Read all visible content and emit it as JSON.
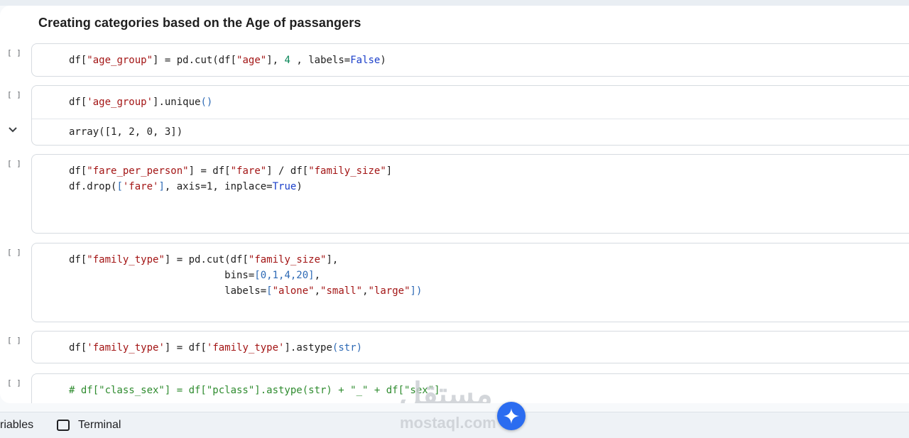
{
  "heading": "Creating categories based on the Age of passangers",
  "run_marker": "[ ]",
  "cells": [
    {
      "lines": [
        [
          [
            "df[",
            "t"
          ],
          [
            "\"age_group\"",
            "s"
          ],
          [
            "] = pd.cut(df[",
            "t"
          ],
          [
            "\"age\"",
            "s"
          ],
          [
            "], ",
            "t"
          ],
          [
            "4",
            "n"
          ],
          [
            " , labels=",
            "t"
          ],
          [
            "False",
            "k"
          ],
          [
            ")",
            "t"
          ]
        ]
      ]
    },
    {
      "lines": [
        [
          [
            "df[",
            "t"
          ],
          [
            "'age_group'",
            "s"
          ],
          [
            "].unique",
            "t"
          ],
          [
            "()",
            "b"
          ]
        ]
      ],
      "output": "array([1, 2, 0, 3])"
    },
    {
      "lines": [
        [
          [
            "df[",
            "t"
          ],
          [
            "\"fare_per_person\"",
            "s"
          ],
          [
            "] = df[",
            "t"
          ],
          [
            "\"fare\"",
            "s"
          ],
          [
            "] / df[",
            "t"
          ],
          [
            "\"family_size\"",
            "s"
          ],
          [
            "]",
            "t"
          ]
        ],
        [
          [
            "df.drop(",
            "t"
          ],
          [
            "[",
            "b"
          ],
          [
            "'fare'",
            "s"
          ],
          [
            "]",
            "b"
          ],
          [
            ", axis=1, inplace=",
            "t"
          ],
          [
            "True",
            "k"
          ],
          [
            ")",
            "t"
          ]
        ]
      ]
    },
    {
      "lines": [
        [
          [
            "df[",
            "t"
          ],
          [
            "\"family_type\"",
            "s"
          ],
          [
            "] = pd.cut(df[",
            "t"
          ],
          [
            "\"family_size\"",
            "s"
          ],
          [
            "],",
            "t"
          ]
        ],
        [
          [
            "                          bins=",
            "t"
          ],
          [
            "[0,1,4,20]",
            "b"
          ],
          [
            ",",
            "t"
          ]
        ],
        [
          [
            "                          labels=",
            "t"
          ],
          [
            "[",
            "b"
          ],
          [
            "\"alone\"",
            "s"
          ],
          [
            ",",
            "t"
          ],
          [
            "\"small\"",
            "s"
          ],
          [
            ",",
            "t"
          ],
          [
            "\"large\"",
            "s"
          ],
          [
            "])",
            "b"
          ]
        ]
      ]
    },
    {
      "lines": [
        [
          [
            "df[",
            "t"
          ],
          [
            "'family_type'",
            "s"
          ],
          [
            "] = df[",
            "t"
          ],
          [
            "'family_type'",
            "s"
          ],
          [
            "].astype",
            "t"
          ],
          [
            "(str)",
            "b"
          ]
        ]
      ]
    },
    {
      "lines": [
        [
          [
            "# df[\"class_sex\"] = df[\"pclass\"].astype(str) + \"_\" + df[\"sex\"]",
            "c"
          ]
        ]
      ]
    }
  ],
  "bottom_tabs": {
    "variables": "riables",
    "terminal": "Terminal"
  },
  "watermark": {
    "arabic": "مستقل",
    "latin": "mostaql.com"
  }
}
